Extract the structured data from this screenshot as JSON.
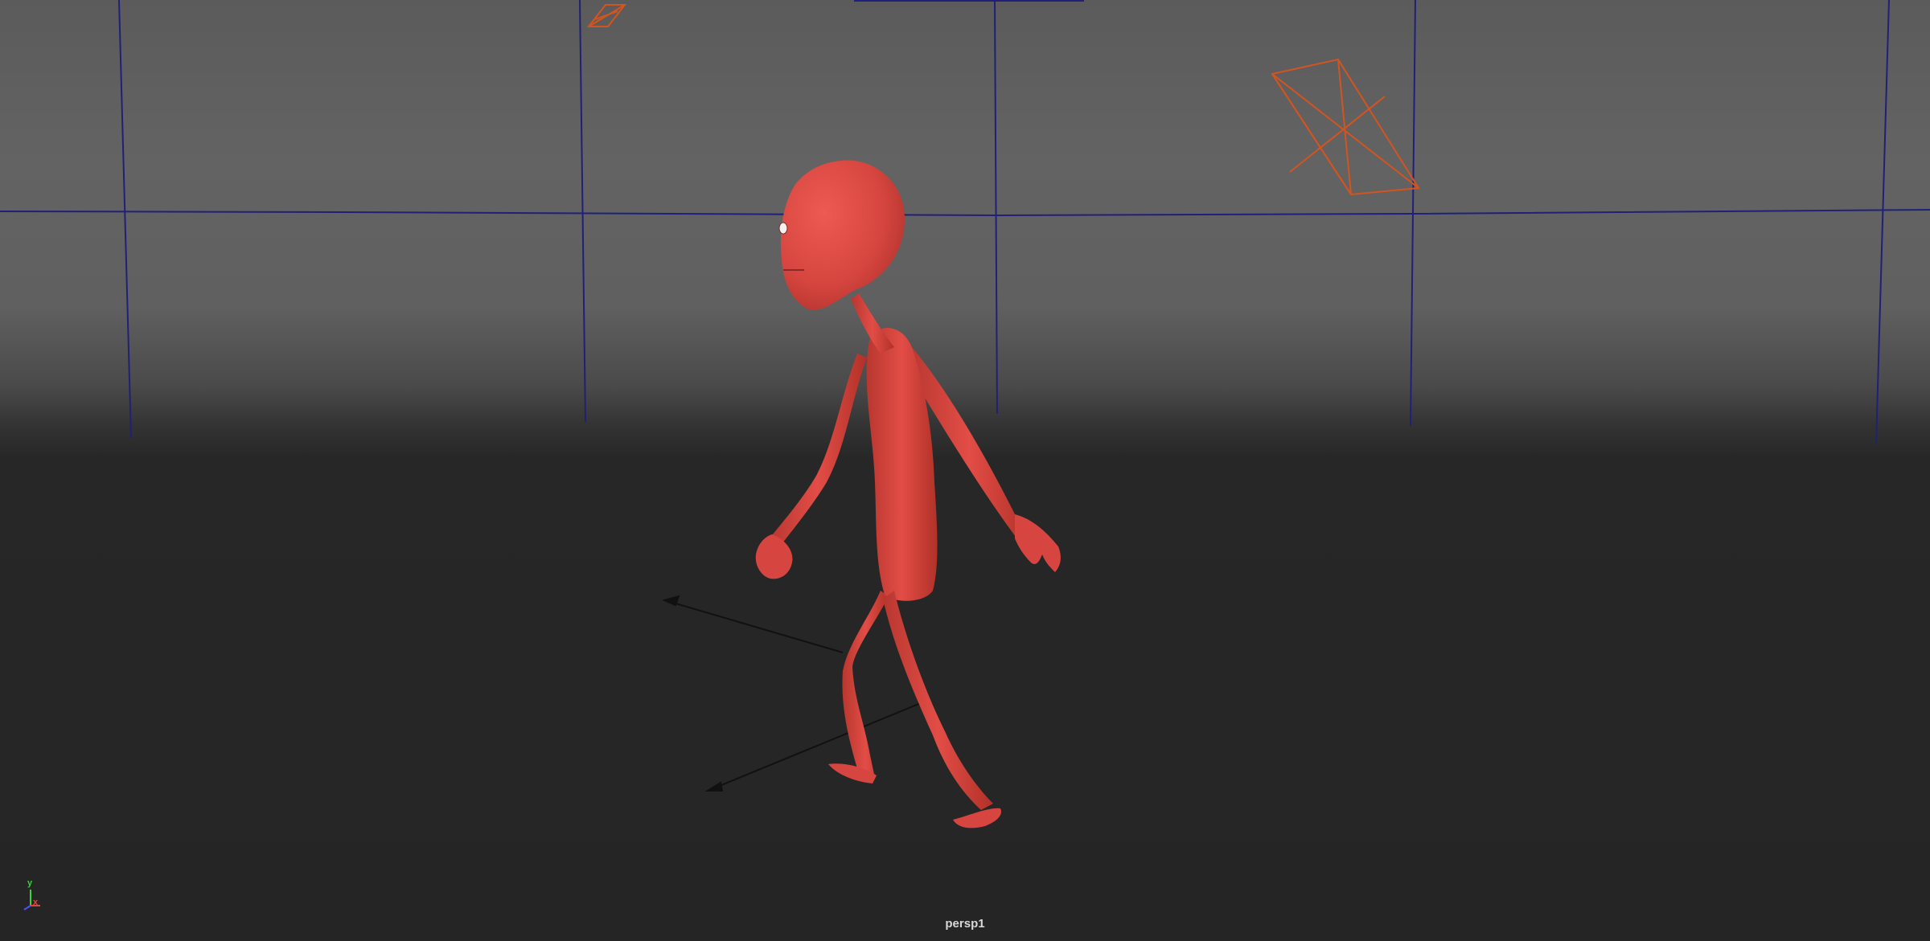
{
  "viewport": {
    "camera_name": "persp1",
    "axis_labels": {
      "y": "y",
      "x": "x"
    }
  },
  "scene_objects": [
    {
      "name": "walking-character",
      "color": "#d6453f"
    },
    {
      "name": "camera-wireframe",
      "color": "#d4541f"
    },
    {
      "name": "light-locator",
      "color": "#d4541f"
    }
  ],
  "colors": {
    "wall": "#606060",
    "floor": "#262626",
    "grid_lines": "#20207a",
    "character": "#d6453f",
    "wireframe": "#d4541f"
  }
}
